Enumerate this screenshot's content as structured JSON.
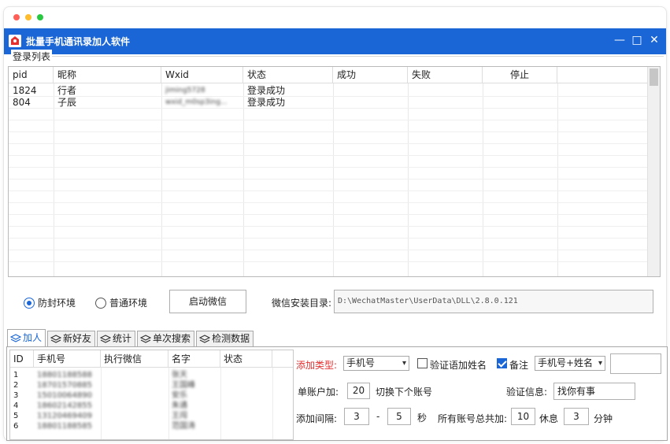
{
  "window": {
    "title": "批量手机通讯录加人软件",
    "controls": {
      "minimize": "—",
      "maximize": "□",
      "close": "✕"
    }
  },
  "login_group": {
    "label": "登录列表",
    "columns": [
      "pid",
      "昵称",
      "Wxid",
      "状态",
      "成功",
      "失败",
      "停止"
    ],
    "rows": [
      {
        "pid": "1824",
        "nickname": "行者",
        "wxid": "jiming5728",
        "status": "登录成功",
        "success": "",
        "fail": "",
        "stop": ""
      },
      {
        "pid": "804",
        "nickname": "子辰",
        "wxid": "wxid_m0sp3ing...",
        "status": "登录成功",
        "success": "",
        "fail": "",
        "stop": ""
      }
    ]
  },
  "environment": {
    "option_1": "防封环境",
    "option_2": "普通环境",
    "selected": "防封环境",
    "start_button": "启动微信",
    "install_dir_label": "微信安装目录:",
    "install_dir_value": "D:\\WechatMaster\\UserData\\DLL\\2.8.0.121"
  },
  "tabs": [
    {
      "label": "加人",
      "icon": "layers-icon",
      "active": true
    },
    {
      "label": "新好友",
      "icon": "layers-icon",
      "active": false
    },
    {
      "label": "统计",
      "icon": "layers-icon",
      "active": false
    },
    {
      "label": "单次搜索",
      "icon": "layers-icon",
      "active": false
    },
    {
      "label": "检测数据",
      "icon": "layers-icon",
      "active": false
    }
  ],
  "add_table": {
    "columns": [
      "ID",
      "手机号",
      "执行微信",
      "名字",
      "状态"
    ],
    "rows": [
      {
        "id": "1",
        "phone": "18801188588",
        "wechat": "",
        "name": "张天",
        "status": ""
      },
      {
        "id": "2",
        "phone": "18701570885",
        "wechat": "",
        "name": "王国峰",
        "status": ""
      },
      {
        "id": "3",
        "phone": "15010064890",
        "wechat": "",
        "name": "安乐",
        "status": ""
      },
      {
        "id": "4",
        "phone": "18602142855",
        "wechat": "",
        "name": "朱通",
        "status": ""
      },
      {
        "id": "5",
        "phone": "13120469409",
        "wechat": "",
        "name": "王闯",
        "status": ""
      },
      {
        "id": "6",
        "phone": "18801188585",
        "wechat": "",
        "name": "范国涛",
        "status": ""
      }
    ]
  },
  "settings": {
    "add_type_label": "添加类型:",
    "add_type_value": "手机号",
    "verify_name_label": "验证语加姓名",
    "verify_name_checked": false,
    "remark_label": "备注",
    "remark_checked": true,
    "remark_value": "手机号+姓名",
    "remark_extra": "",
    "per_account_label": "单账户加:",
    "per_account_value": "20",
    "switch_label": "切换下个账号",
    "verify_msg_label": "验证信息:",
    "verify_msg_value": "找你有事",
    "interval_label": "添加间隔:",
    "interval_min": "3",
    "interval_dash": "-",
    "interval_max": "5",
    "interval_unit": "秒",
    "total_label": "所有账号总共加:",
    "total_value": "10",
    "rest_label": "休息",
    "rest_value": "3",
    "rest_unit": "分钟"
  },
  "colors": {
    "titlebar": "#1a66d6",
    "accent": "#1a66d6",
    "required_label": "#e53030"
  }
}
